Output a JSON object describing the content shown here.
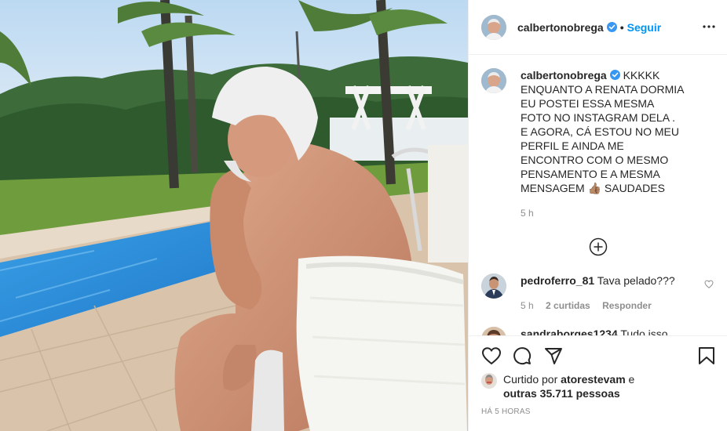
{
  "header": {
    "username": "calbertonobrega",
    "separator": "•",
    "follow_label": "Seguir"
  },
  "caption": {
    "username": "calbertonobrega",
    "text": "KKKKK ENQUANTO A RENATA DORMIA EU POSTEI ESSA MESMA FOTO NO INSTAGRAM DELA . E AGORA, CÁ ESTOU NO MEU PERFIL E AINDA ME ENCONTRO COM O MESMO PENSAMENTO E A MESMA MENSAGEM 👍🏽 SAUDADES",
    "time": "5 h"
  },
  "comments": [
    {
      "username": "pedroferro_81",
      "text": "Tava pelado???",
      "time": "5 h",
      "likes": "2 curtidas",
      "reply_label": "Responder"
    },
    {
      "username": "sandraborges1234",
      "text": "Tudo isso vai..."
    }
  ],
  "likes": {
    "prefix": "Curtido por",
    "user": "atorestevam",
    "connector": "e",
    "others": "outras 35.711 pessoas"
  },
  "timestamp": "HÁ 5 HORAS",
  "colors": {
    "accent": "#0095f6",
    "verified": "#3897f0",
    "text": "#262626",
    "muted": "#8e8e8e",
    "divider": "#efefef"
  },
  "icons": [
    "more-options-icon",
    "verified-badge-icon",
    "load-more-icon",
    "heart-icon",
    "comment-icon",
    "share-icon",
    "bookmark-icon"
  ]
}
